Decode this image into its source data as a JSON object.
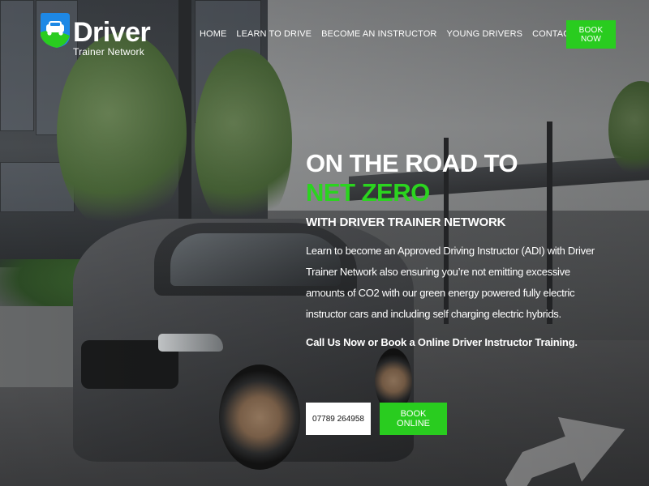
{
  "brand": {
    "title": "Driver",
    "subtitle": "Trainer Network",
    "logo_icon": "car-badge-icon",
    "colors": {
      "accent": "#29cc1f",
      "logo_blue": "#1e88e5"
    }
  },
  "nav": {
    "items": [
      {
        "label": "HOME"
      },
      {
        "label": "LEARN TO DRIVE"
      },
      {
        "label": "BECOME AN INSTRUCTOR"
      },
      {
        "label": "YOUNG DRIVERS"
      },
      {
        "label": "CONTACT US"
      }
    ],
    "book_label": "BOOK NOW"
  },
  "hero": {
    "line1": "ON THE ROAD TO",
    "line2": "NET ZERO",
    "subheading": "WITH DRIVER TRAINER NETWORK",
    "paragraph": "Learn to become an Approved Driving Instructor (ADI) with Driver Trainer Network also ensuring you’re not emitting excessive amounts of CO2 with our green energy powered fully electric instructor cars and including self charging electric hybrids.",
    "cta": "Call Us Now or Book a Online Driver Instructor Training.",
    "phone_label": "07789 264958",
    "book_online_label": "BOOK ONLINE"
  }
}
